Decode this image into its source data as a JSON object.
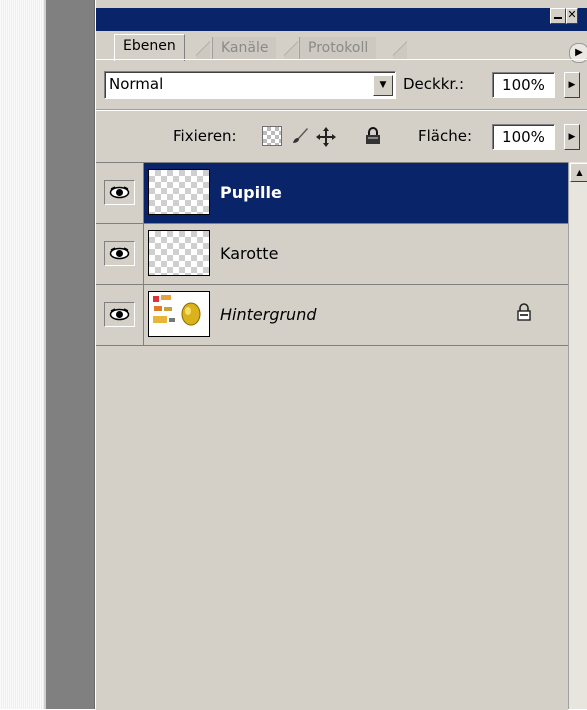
{
  "window": {
    "minimize_icon": "minimize-icon",
    "close_icon": "close-icon",
    "title_color": "#0a246a"
  },
  "tabs": [
    {
      "label": "Ebenen",
      "active": true
    },
    {
      "label": "Kanäle",
      "active": false
    },
    {
      "label": "Protokoll",
      "active": false
    }
  ],
  "options": {
    "blend_mode": "Normal",
    "opacity_label": "Deckkr.:",
    "opacity_value": "100%",
    "lock_label": "Fixieren:",
    "fill_label": "Fläche:",
    "fill_value": "100%"
  },
  "layers": [
    {
      "name": "Pupille",
      "visible": true,
      "selected": true,
      "locked": false
    },
    {
      "name": "Karotte",
      "visible": true,
      "selected": false,
      "locked": false
    },
    {
      "name": "Hintergrund",
      "visible": true,
      "selected": false,
      "locked": true
    }
  ],
  "colors": {
    "selection": "#0a246a",
    "panel": "#d4d0c8"
  }
}
